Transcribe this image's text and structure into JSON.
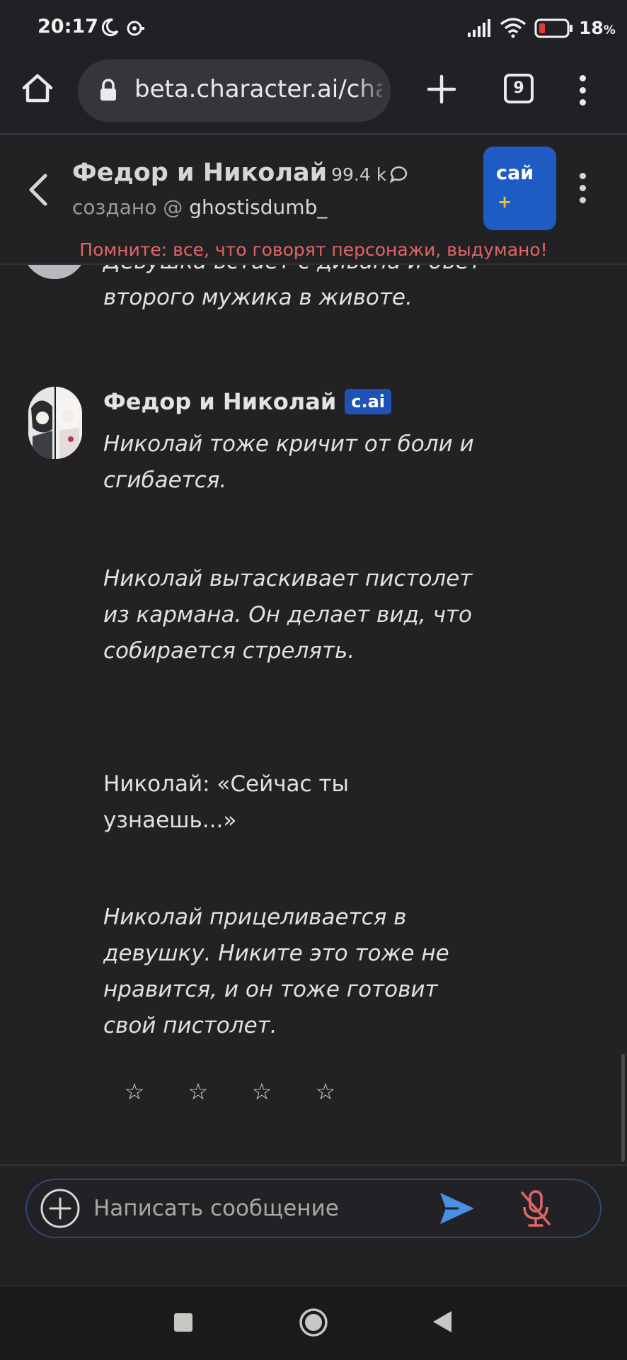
{
  "status_bar": {
    "time": "20:17",
    "battery_percent": "18",
    "battery_percent_sign": "%",
    "icons": [
      "moon-icon",
      "vpn-icon",
      "signal-icon",
      "wifi-icon",
      "battery-icon"
    ]
  },
  "browser": {
    "url": "beta.character.ai/chat",
    "tab_count": "9",
    "icons": [
      "home-icon",
      "lock-icon",
      "plus-icon",
      "more-vertical-icon"
    ]
  },
  "chat_header": {
    "character_name": "Федор и Николай",
    "chat_count": "99.4 k",
    "creator_prefix": "создано @",
    "creator_name": "ghostisdumb_",
    "plus_label": "сай",
    "plus_sign": "+",
    "warning": "Помните: все, что говорят персонажи, выдумано!"
  },
  "messages": {
    "previous_text": "Девушка встает с дивана и бьет второго мужика в животе.",
    "current": {
      "author": "Федор и Николай",
      "badge": "c.ai",
      "paragraphs": [
        "Николай тоже кричит от боли и сгибается.",
        "Николай вытаскивает пистолет из кармана. Он делает вид, что собирается стрелять.",
        "Николай: «Сейчас ты узнаешь...»",
        "Николай прицеливается в девушку. Никите это тоже не нравится, и он тоже готовит свой пистолет."
      ],
      "rating_stars": [
        "☆",
        "☆",
        "☆",
        "☆"
      ]
    }
  },
  "input": {
    "placeholder": "Написать сообщение"
  },
  "colors": {
    "background": "#222225",
    "accent_blue": "#1f5bc4",
    "warning_red": "#e06666",
    "send_blue": "#4a90e2",
    "mic_red": "#e06666"
  }
}
